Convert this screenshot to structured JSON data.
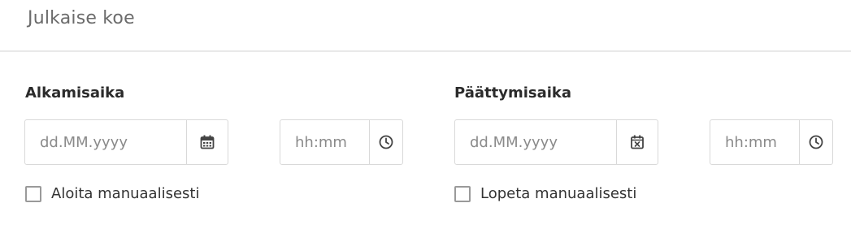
{
  "header": {
    "title": "Julkaise koe"
  },
  "start": {
    "label": "Alkamisaika",
    "date_placeholder": "dd.MM.yyyy",
    "date_icon": "calendar-icon",
    "time_placeholder": "hh:mm",
    "time_icon": "clock-icon",
    "manual_label": "Aloita manuaalisesti",
    "manual_checked": false
  },
  "end": {
    "label": "Päättymisaika",
    "date_placeholder": "dd.MM.yyyy",
    "date_icon": "calendar-x-icon",
    "time_placeholder": "hh:mm",
    "time_icon": "clock-icon",
    "manual_label": "Lopeta manuaalisesti",
    "manual_checked": false
  },
  "colors": {
    "border": "#d9d9d9",
    "icon": "#444444",
    "divider": "#e9e9e9"
  }
}
